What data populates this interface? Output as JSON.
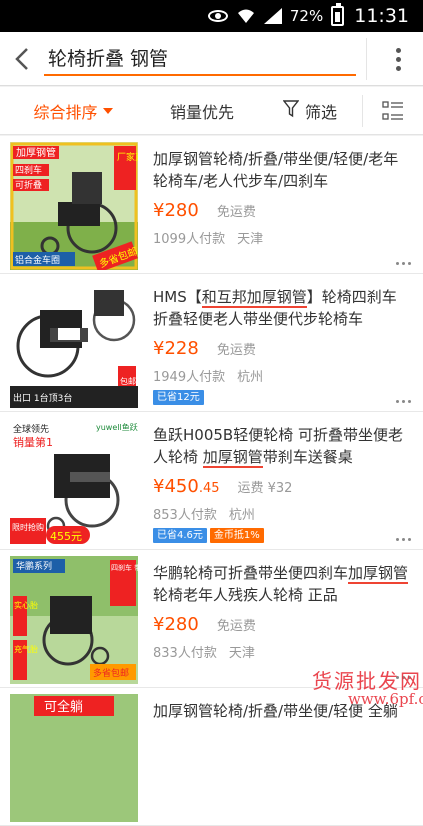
{
  "status_bar": {
    "battery": "72%",
    "time": "11:31"
  },
  "search": {
    "query": "轮椅折叠 钢管"
  },
  "filters": [
    {
      "label": "综合排序",
      "active": true
    },
    {
      "label": "销量优先",
      "active": false
    },
    {
      "label": "筛选",
      "active": false
    }
  ],
  "items": [
    {
      "title": "加厚钢管轮椅/折叠/带坐便/轻便/老年轮椅车/老人代步车/四刹车",
      "price": "¥280",
      "shipping": "免运费",
      "sales": "1099人付款",
      "location": "天津",
      "thumb_text": {
        "a": "加厚钢管",
        "b": "四刹车",
        "c": "可折叠",
        "d": "厂家直销",
        "e": "铝合金车圈",
        "f": "多省包邮"
      }
    },
    {
      "title_pre": "HMS【",
      "title_hl": "和互邦加厚钢管",
      "title_post": "】轮椅四刹车折叠轻便老人带坐便代步轮椅车",
      "price": "¥228",
      "shipping": "免运费",
      "sales": "1949人付款",
      "location": "杭州",
      "tag": "已省12元",
      "thumb_text": {
        "a": "出口 1台顶3台",
        "b": "包邮"
      }
    },
    {
      "title_pre": "鱼跃H005B轻便轮椅 可折叠带坐便老人轮椅 ",
      "title_hl": "加厚钢管",
      "title_post": "带刹车送餐桌",
      "price_int": "¥450",
      "price_dec": ".45",
      "shipping": "运费 ¥32",
      "sales": "853人付款",
      "location": "杭州",
      "tag1": "已省4.6元",
      "tag2": "金币抵1%",
      "thumb_text": {
        "a": "全球领先",
        "b": "销量第1",
        "c": "yuwell鱼跃",
        "d": "限时抢购",
        "e": "455元"
      }
    },
    {
      "title_pre": "华鹏轮椅可折叠带坐便四刹车",
      "title_hl": "加厚钢管",
      "title_post": "轮椅老年人残疾人轮椅 正品",
      "price": "¥280",
      "shipping": "免运费",
      "sales": "833人付款",
      "location": "天津",
      "thumb_text": {
        "a": "华鹏系列",
        "b": "实心胎",
        "c": "充气胎",
        "d": "多省包邮",
        "e": "四刹车 带座便 可折叠"
      }
    },
    {
      "title": "加厚钢管轮椅/折叠/带坐便/轻便 全躺",
      "thumb_text": {
        "a": "可全躺"
      }
    }
  ],
  "watermark": {
    "line1": "货源批发网",
    "line2": "www.6pf.cn"
  }
}
